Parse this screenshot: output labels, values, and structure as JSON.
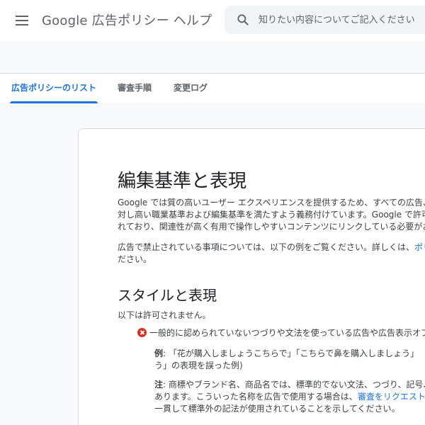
{
  "header": {
    "product_title": "Google 広告ポリシー ヘルプ",
    "search_placeholder": "知りたい内容についてご記入ください"
  },
  "tabs": [
    {
      "label": "広告ポリシーのリスト",
      "active": true
    },
    {
      "label": "審査手順",
      "active": false
    },
    {
      "label": "変更ログ",
      "active": false
    }
  ],
  "article": {
    "title": "編集基準と表現",
    "intro_lines": [
      "Google では質の高いユーザー エクスペリエンスを提供するため、すべての広告、",
      "対し高い職業基準および編集基準を満たすよう義務付けています。Google で許可",
      "れており、関連性が高く有用で操作しやすいコンテンツにリンクしている必要がお"
    ],
    "prohibited_note": {
      "text": "広告で禁止されている事項については、以下の例をご覧ください。詳しくは、",
      "link": "ポリ",
      "line2": "ださい。"
    },
    "section_title": "スタイルと表現",
    "section_intro": "以下は許可されません。",
    "item": {
      "text": "一般的に認められていないつづりや文法を使っている広告や広告表示オプ",
      "example_label": "例",
      "example_line1": ": 「花が購入しましょうこちらで」「こちらで鼻を購入しましょう」",
      "example_line2": "う」の表現を誤った例)",
      "note_label": "注",
      "note_line1": ": 商標やブランド名、商品名では、標準的でない文法、つづり、記号、",
      "note_line2_pre": "あります。こういった名称を広告で使用する場合は、",
      "note_link": "審査をリクエスト",
      "note_line3": "一貫して標準外の記法が使用されていることを示してください。"
    }
  },
  "colors": {
    "accent": "#1a73e8",
    "prohibited": "#d93025"
  }
}
